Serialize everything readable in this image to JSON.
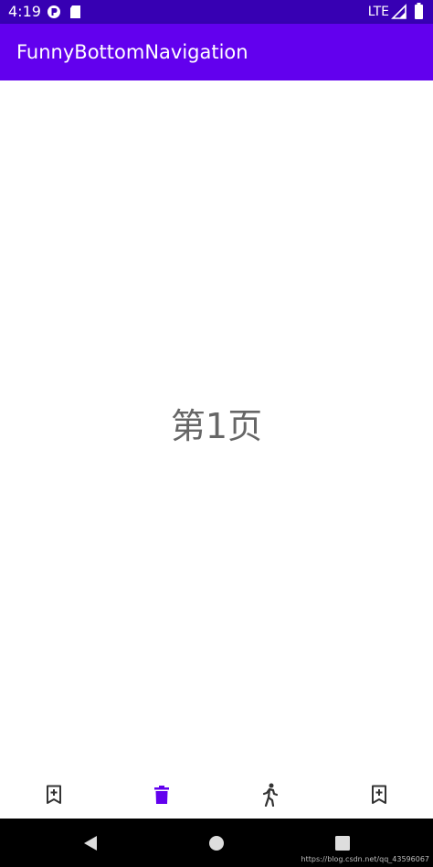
{
  "status_bar": {
    "time": "4:19",
    "network": "LTE",
    "left_icons": [
      "notification-icon",
      "sd-card-icon"
    ],
    "right_icons": [
      "signal-icon",
      "battery-icon"
    ]
  },
  "app_bar": {
    "title": "FunnyBottomNavigation"
  },
  "content": {
    "page_label": "第1页"
  },
  "bottom_nav": {
    "items": [
      {
        "icon": "bookmark-add-icon",
        "selected": false
      },
      {
        "icon": "delete-icon",
        "selected": true
      },
      {
        "icon": "walk-icon",
        "selected": false
      },
      {
        "icon": "bookmark-add-icon",
        "selected": false
      }
    ],
    "selected_color": "#6200ee",
    "unselected_color": "#333333"
  },
  "system_nav": {
    "buttons": [
      "back-icon",
      "home-icon",
      "recents-icon"
    ]
  },
  "watermark": "https://blog.csdn.net/qq_43596067",
  "colors": {
    "status_bar": "#3700b3",
    "app_bar": "#6200ee",
    "accent": "#6200ee"
  }
}
